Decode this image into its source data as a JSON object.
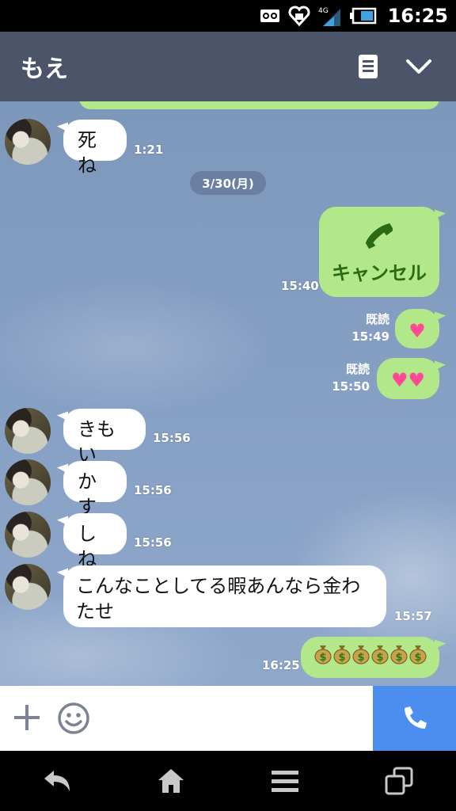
{
  "status_bar": {
    "time": "16:25",
    "network": "4G",
    "icons": [
      "voicemail-icon",
      "heart-notification-icon",
      "signal-icon",
      "battery-icon"
    ]
  },
  "header": {
    "title": "もえ",
    "icons": [
      "notes-icon",
      "chevron-down-icon"
    ]
  },
  "chat": {
    "date_separator": "3/30(月)",
    "messages": [
      {
        "side": "left",
        "text": "死ね",
        "time": "1:21"
      },
      {
        "side": "right",
        "type": "call",
        "text": "キャンセル",
        "time": "15:40"
      },
      {
        "side": "right",
        "type": "sticker",
        "text": "💗",
        "read": "既読",
        "time": "15:49"
      },
      {
        "side": "right",
        "type": "sticker",
        "text": "💗💗",
        "read": "既読",
        "time": "15:50"
      },
      {
        "side": "left",
        "text": "きもい",
        "time": "15:56"
      },
      {
        "side": "left",
        "text": "かす",
        "time": "15:56"
      },
      {
        "side": "left",
        "text": "しね",
        "time": "15:56"
      },
      {
        "side": "left",
        "text": "こんなことしてる暇あんなら金わたせ",
        "time": "15:57"
      },
      {
        "side": "right",
        "type": "emoji",
        "text": "moneybag x6",
        "time": "16:25"
      }
    ]
  },
  "input_bar": {
    "icons": [
      "plus-icon",
      "smile-icon",
      "phone-icon"
    ]
  },
  "colors": {
    "header_bg": "#4b5468",
    "bubble_green": "#b3e88a",
    "call_blue": "#4b8ef0"
  }
}
